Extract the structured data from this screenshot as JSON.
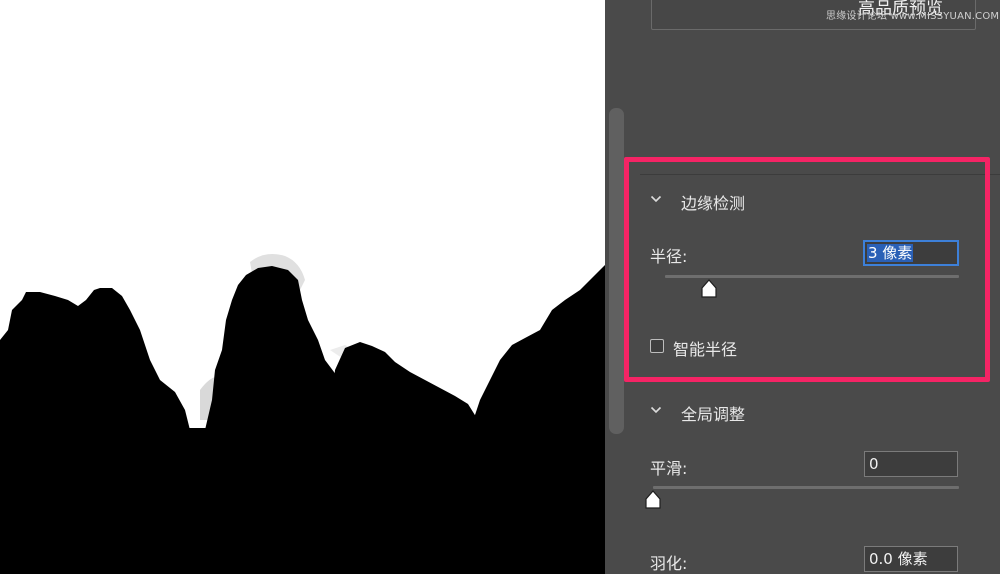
{
  "preview": {
    "label": "高品质预览"
  },
  "watermark": "思缘设计论坛 www.MISSYUAN.COM",
  "edge_detection": {
    "title": "边缘检测",
    "radius_label": "半径:",
    "radius_value": "3 像素",
    "radius_slider_fraction": 0.15,
    "smart_radius_label": "智能半径",
    "smart_radius_checked": false
  },
  "global_refine": {
    "title": "全局调整",
    "smooth_label": "平滑:",
    "smooth_value": "0",
    "smooth_slider_fraction": 0.0,
    "feather_label": "羽化:",
    "feather_value": "0.0 像素"
  },
  "colors": {
    "highlight": "#f52465",
    "panel_bg": "#4a4a4a",
    "selection": "#2a60b6"
  }
}
